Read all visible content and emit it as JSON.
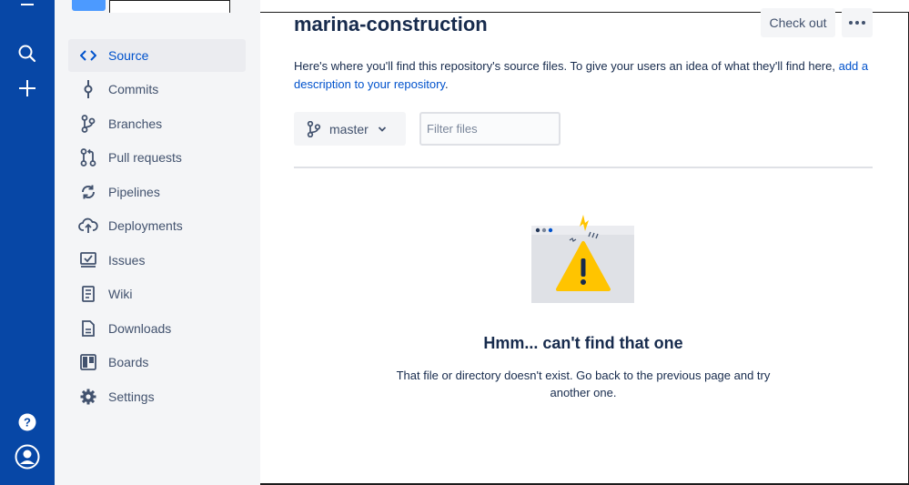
{
  "global_nav": {
    "icons": [
      "menu-icon",
      "search-icon",
      "plus-icon",
      "help-icon",
      "profile-icon"
    ],
    "color": "#0747a6"
  },
  "sidebar": {
    "items": [
      {
        "label": "Source",
        "icon": "code-icon",
        "active": true
      },
      {
        "label": "Commits",
        "icon": "commit-icon"
      },
      {
        "label": "Branches",
        "icon": "branch-icon"
      },
      {
        "label": "Pull requests",
        "icon": "pull-request-icon"
      },
      {
        "label": "Pipelines",
        "icon": "pipelines-icon"
      },
      {
        "label": "Deployments",
        "icon": "cloud-upload-icon"
      },
      {
        "label": "Issues",
        "icon": "issues-icon"
      },
      {
        "label": "Wiki",
        "icon": "wiki-icon"
      },
      {
        "label": "Downloads",
        "icon": "downloads-icon"
      },
      {
        "label": "Boards",
        "icon": "boards-icon"
      },
      {
        "label": "Settings",
        "icon": "gear-icon"
      }
    ]
  },
  "main": {
    "title": "marina-construction",
    "checkout_label": "Check out",
    "description_text": "Here's where you'll find this repository's source files. To give your users an idea of what they'll find here, ",
    "description_link": "add a description to your repository",
    "description_end": ".",
    "branch_label": "master",
    "filter_placeholder": "Filter files",
    "empty_title": "Hmm... can't find that one",
    "empty_message": "That file or directory doesn't exist. Go back to the previous page and try another one."
  },
  "colors": {
    "accent": "#0052cc",
    "sidebar_bg": "#f4f5f7",
    "warning": "#ffc400"
  }
}
